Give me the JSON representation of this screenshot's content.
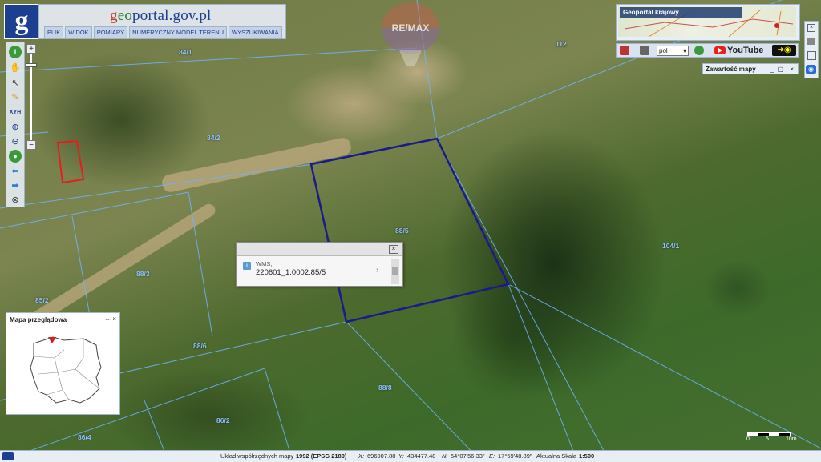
{
  "header": {
    "logo_letter": "g",
    "title_prefix": "g",
    "title_accent": "eo",
    "title_rest": "portal.gov.pl",
    "menu": [
      "PLIK",
      "WIDOK",
      "POMIARY",
      "NUMERYCZNY MODEL TERENU",
      "WYSZUKIWANIA"
    ]
  },
  "watermark": "RE/MAX",
  "locator": {
    "label": "Geoportal krajowy"
  },
  "toolrow": {
    "language": "pol",
    "youtube": "YouTube"
  },
  "contents_panel": {
    "title": "Zawartość mapy"
  },
  "parcels": [
    "112",
    "84/1",
    "84/2",
    "88/3",
    "85/2",
    "88/5",
    "88/6",
    "104/1",
    "86/2",
    "86/4",
    "88/8"
  ],
  "popup": {
    "source": "WMS,",
    "value": "220601_1.0002.85/5"
  },
  "overview": {
    "title": "Mapa przeglądowa"
  },
  "scale": {
    "labels": [
      "0",
      "5",
      "10m"
    ]
  },
  "footer": {
    "crs_prefix": "Układ współrzędnych mapy",
    "crs_value": "1992 (EPSG 2180)",
    "x_label": "X:",
    "x_value": "696907.88",
    "y_label": "Y:",
    "y_value": "434477.48",
    "n_label": "N:",
    "n_value": "54°07'56.33\"",
    "e_label": "E:",
    "e_value": "17°59'48.89\"",
    "scale_label": "Aktualna Skala",
    "scale_value": "1:500"
  },
  "colors": {
    "brand": "#1c3f8f",
    "parcel_line": "#6fb4ff",
    "selected_parcel": "#1a1a8c",
    "building_outline": "#e02020"
  }
}
